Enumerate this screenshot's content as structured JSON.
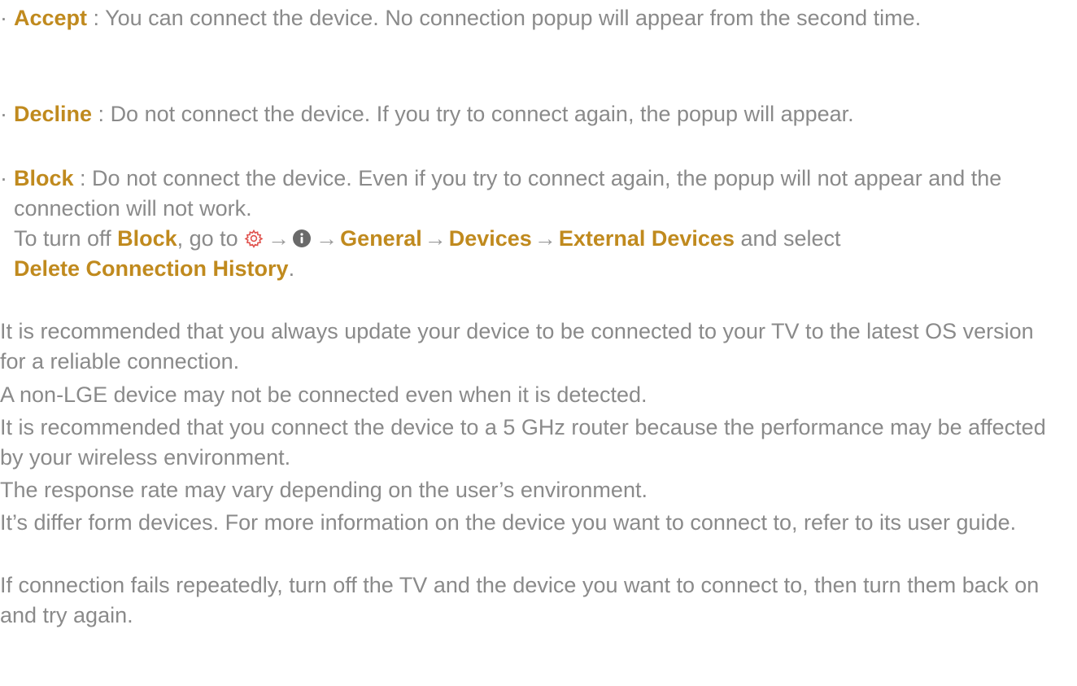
{
  "bullets": [
    {
      "term": "Accept",
      "separator": " : ",
      "desc": "You can connect the device. No connection popup will appear from the second time."
    },
    {
      "term": "Decline",
      "separator": " : ",
      "desc": "Do not connect the device. If you try to connect again, the popup will appear."
    },
    {
      "term": "Block",
      "separator": " : ",
      "desc": "Do not connect the device. Even if you try to connect again, the popup will not appear and the connection will not work."
    }
  ],
  "block_howto": {
    "prefix": "To turn off ",
    "term": "Block",
    "mid": ", go to ",
    "icon_settings": "gear-icon",
    "icon_info": "info-icon",
    "arrow": "→",
    "path": [
      "General",
      "Devices",
      "External Devices"
    ],
    "suffix": " and select",
    "action": "Delete Connection History",
    "end": "."
  },
  "notes": [
    "It is recommended that you always update your device to be connected to your TV to the latest OS version for a reliable connection.",
    "A non-LGE device may not be connected even when it is detected.",
    "It is recommended that you connect the device to a 5 GHz router because the performance may be affected by your wireless environment.",
    "The response rate may vary depending on the user’s environment.",
    "It’s differ form devices. For more information on the device you want to connect to, refer to its user guide.",
    "If connection fails repeatedly, turn off the TV and the device you want to connect to, then turn them back on and try again."
  ],
  "colors": {
    "text": "#8a8a8a",
    "accent": "#c08a1e",
    "settings_icon": "#e0524d",
    "info_icon": "#6a6a6a"
  }
}
